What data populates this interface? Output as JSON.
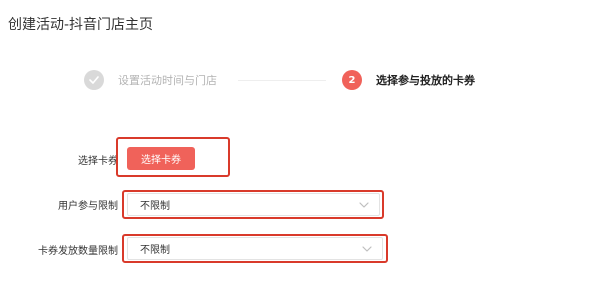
{
  "header": {
    "title": "创建活动-抖音门店主页"
  },
  "steps": [
    {
      "label": "设置活动时间与门店",
      "status": "done"
    },
    {
      "number": "2",
      "label": "选择参与投放的卡券",
      "status": "active"
    }
  ],
  "form": {
    "coupon": {
      "label": "选择卡券",
      "button_label": "选择卡券"
    },
    "user_limit": {
      "label": "用户参与限制",
      "value": "不限制"
    },
    "coupon_quantity_limit": {
      "label": "卡券发放数量限制",
      "value": "不限制"
    }
  },
  "colors": {
    "accent": "#f0625a",
    "highlight_border": "#d93a2b",
    "step_done": "#d9d9d9"
  }
}
